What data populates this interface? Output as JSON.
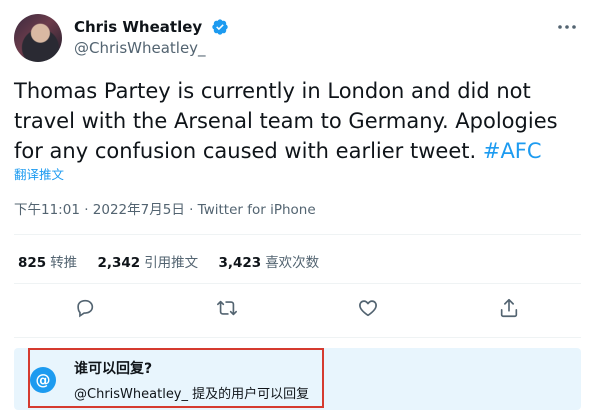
{
  "author": {
    "display_name": "Chris Wheatley",
    "handle": "@ChrisWheatley_"
  },
  "tweet": {
    "text_main": "Thomas Partey is currently in London and did not travel with the Arsenal team to Germany. Apologies for any confusion caused with earlier tweet.",
    "hashtag": "#AFC",
    "translate_label": "翻译推文",
    "meta": "下午11:01 · 2022年7月5日 · Twitter for iPhone"
  },
  "stats": {
    "retweets_num": "825",
    "retweets_label": "转推",
    "quotes_num": "2,342",
    "quotes_label": "引用推文",
    "likes_num": "3,423",
    "likes_label": "喜欢次数"
  },
  "reply_restriction": {
    "icon_glyph": "@",
    "title": "谁可以回复?",
    "description": "@ChrisWheatley_ 提及的用户可以回复"
  },
  "colors": {
    "accent": "#1d9bf0",
    "reply_box_bg": "#e8f5fd",
    "highlight_border": "#d53a2f",
    "secondary_text": "#536471"
  }
}
